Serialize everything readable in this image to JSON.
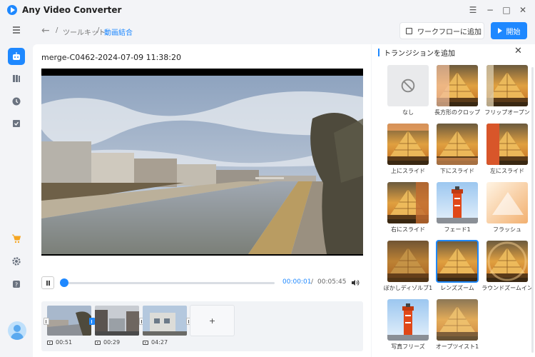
{
  "app": {
    "title": "Any Video Converter"
  },
  "window_controls": [
    "☰",
    "−",
    "□",
    "✕"
  ],
  "breadcrumb": {
    "sep": "/",
    "items": [
      "ツールキット",
      "動画結合"
    ]
  },
  "toolbar": {
    "workflow_label": "ワークフローに追加",
    "start_label": "開始"
  },
  "player": {
    "file_title": "merge-C0462-2024-07-09 11:38:20",
    "current_time": "00:00:01",
    "time_sep": "/",
    "total_time": "00:05:45",
    "progress": 0.003
  },
  "timeline": {
    "clips": [
      {
        "duration": "00:51"
      },
      {
        "duration": "00:29"
      },
      {
        "duration": "04:27"
      }
    ],
    "add_label": "+"
  },
  "transitions": {
    "title": "トランジションを追加",
    "items": [
      {
        "label": "なし"
      },
      {
        "label": "長方形のクロップ"
      },
      {
        "label": "フリップオープン"
      },
      {
        "label": "上にスライド"
      },
      {
        "label": "下にスライド"
      },
      {
        "label": "左にスライド"
      },
      {
        "label": "右にスライド"
      },
      {
        "label": "フェード1"
      },
      {
        "label": "フラッシュ"
      },
      {
        "label": "ぼかしディゾルブ1"
      },
      {
        "label": "レンズズーム"
      },
      {
        "label": "ラウンドズームイン"
      },
      {
        "label": "写真フリーズ"
      },
      {
        "label": "オープツイスト1"
      }
    ],
    "selected": "レンズズーム"
  },
  "colors": {
    "accent": "#1e88ff",
    "background": "#f3f4f7"
  }
}
